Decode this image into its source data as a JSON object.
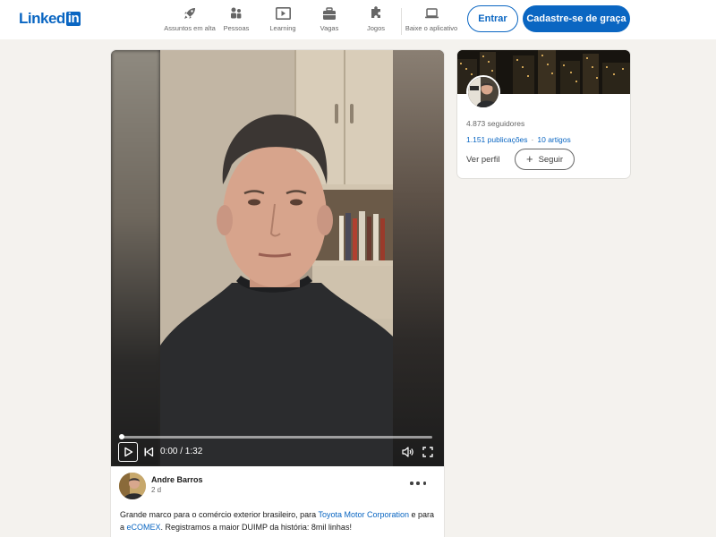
{
  "header": {
    "logo_text": "Linked",
    "logo_in": "in",
    "nav": [
      {
        "label": "Assuntos em alta",
        "icon": "rocket-icon"
      },
      {
        "label": "Pessoas",
        "icon": "people-icon"
      },
      {
        "label": "Learning",
        "icon": "play-icon"
      },
      {
        "label": "Vagas",
        "icon": "briefcase-icon"
      },
      {
        "label": "Jogos",
        "icon": "puzzle-icon"
      },
      {
        "label": "Baixe o aplicativo",
        "icon": "laptop-icon"
      }
    ],
    "entrar_label": "Entrar",
    "cadastre_label": "Cadastre-se de graça"
  },
  "video": {
    "time": "0:00 / 1:32",
    "progress": 0
  },
  "post": {
    "author": "Andre Barros",
    "time_ago": "2 d",
    "text_1": "Grande marco para o comércio exterior brasileiro, para ",
    "mention_1": "Toyota Motor Corporation",
    "text_2": "  e para a ",
    "mention_2": "eCOMEX",
    "text_3": ". Registramos a maior DUIMP da história: 8mil linhas!"
  },
  "profile": {
    "followers": "4.873 seguidores",
    "publications": "1.151 publicações",
    "separator": "·",
    "articles": "10 artigos",
    "ver_perfil": "Ver perfil",
    "seguir_label": "Seguir",
    "seguir_icon": "+"
  },
  "colors": {
    "brand": "#0a66c2",
    "background": "#f4f2ee"
  }
}
